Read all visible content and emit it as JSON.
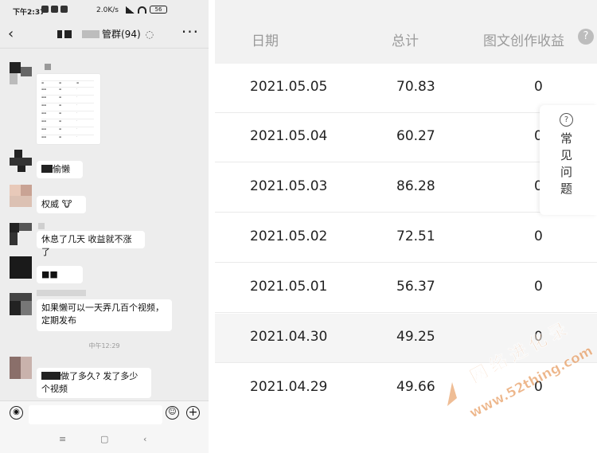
{
  "statusbar": {
    "time": "下午2:37",
    "speed": "2.0K/s",
    "battery": "56"
  },
  "chat": {
    "title_suffix": "管群(94)",
    "messages": [
      {
        "text": "偷懒"
      },
      {
        "text": "权威"
      },
      {
        "text": "休息了几天 收益就不涨了"
      },
      {
        "text": "■■"
      },
      {
        "text": "如果懒可以一天弄几百个视频，定期发布"
      },
      {
        "text": "做了多久? 发了多少个视频"
      }
    ],
    "timestamp": "中午12:29"
  },
  "nav": {
    "menu": "≡",
    "home": "▢",
    "back": "‹"
  },
  "table": {
    "headers": {
      "date": "日期",
      "total": "总计",
      "income": "图文创作收益"
    },
    "rows": [
      {
        "date": "2021.05.05",
        "total": "70.83",
        "income": "0"
      },
      {
        "date": "2021.05.04",
        "total": "60.27",
        "income": "0"
      },
      {
        "date": "2021.05.03",
        "total": "86.28",
        "income": "0"
      },
      {
        "date": "2021.05.02",
        "total": "72.51",
        "income": "0"
      },
      {
        "date": "2021.05.01",
        "total": "56.37",
        "income": "0"
      },
      {
        "date": "2021.04.30",
        "total": "49.25",
        "income": "0"
      },
      {
        "date": "2021.04.29",
        "total": "49.66",
        "income": "0"
      }
    ]
  },
  "help": {
    "label": "常见问题"
  },
  "watermark": {
    "site": "网络进化录",
    "url": "www.52thing.com"
  },
  "colors": {
    "chat_bg": "#ededed",
    "header_bg": "#f2f2f2",
    "watermark": "#e07b2c"
  }
}
